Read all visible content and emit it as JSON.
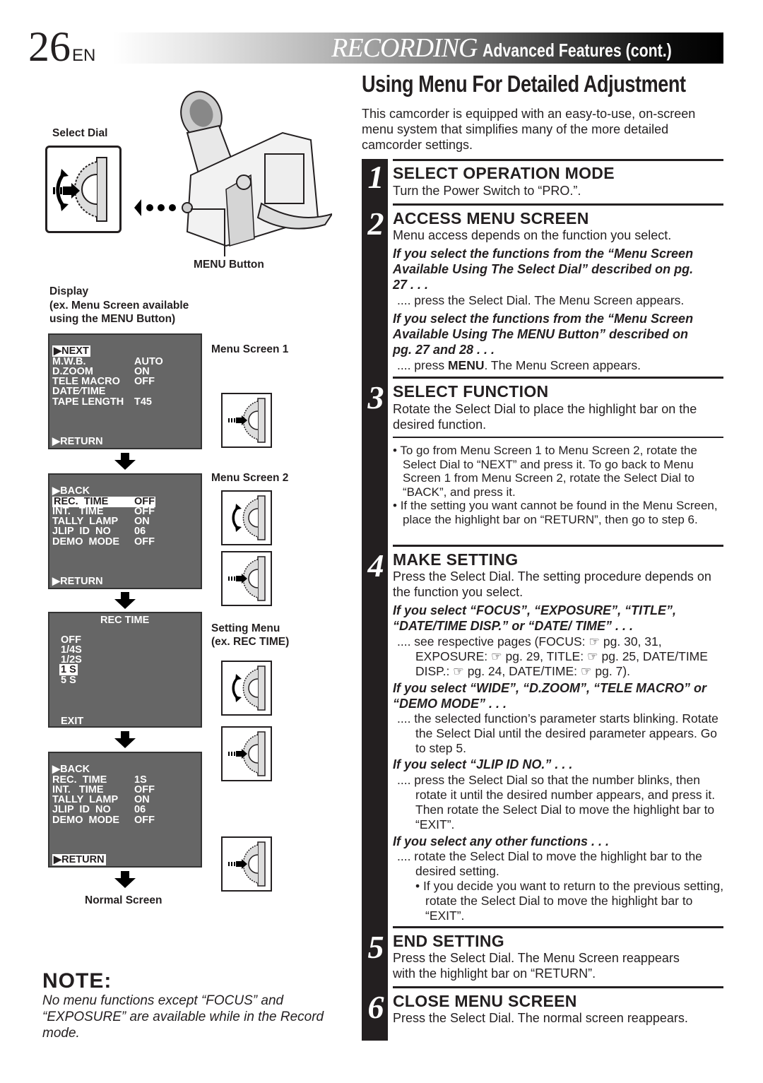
{
  "header": {
    "page_number": "26",
    "lang": "EN",
    "section": "RECORDING",
    "subsection": "Advanced Features (cont.)"
  },
  "title": "Using Menu For Detailed Adjustment",
  "intro": "This camcorder is equipped with an easy-to-use, on-screen menu system that simplifies many of the more detailed camcorder settings.",
  "illustration": {
    "select_dial_label": "Select Dial",
    "menu_button_label": "MENU Button",
    "display_label": "Display",
    "display_sub1": "(ex. Menu Screen available",
    "display_sub2": "using the MENU Button)",
    "menu_screen_1_label": "Menu Screen 1",
    "menu_screen_2_label": "Menu Screen 2",
    "setting_menu_label": "Setting Menu",
    "setting_menu_sub": "(ex. REC TIME)",
    "normal_screen_label": "Normal Screen"
  },
  "screens": {
    "menu1": {
      "rows": [
        {
          "label": "▶NEXT",
          "value": "",
          "highlight": true
        },
        {
          "label": "M.W.B.",
          "value": "AUTO"
        },
        {
          "label": "D.ZOOM",
          "value": "ON"
        },
        {
          "label": "TELE MACRO",
          "value": "OFF"
        },
        {
          "label": "DATE⁄TIME",
          "value": ""
        },
        {
          "label": "TAPE LENGTH",
          "value": "T45"
        }
      ],
      "footer": "▶RETURN"
    },
    "menu2": {
      "rows": [
        {
          "label": "▶BACK",
          "value": ""
        },
        {
          "label": "REC.  TIME",
          "value": "OFF",
          "highlight": true
        },
        {
          "label": "INT.   TIME",
          "value": "OFF"
        },
        {
          "label": "TALLY  LAMP",
          "value": "ON"
        },
        {
          "label": "JLIP  ID  NO",
          "value": "06"
        },
        {
          "label": "DEMO  MODE",
          "value": "OFF"
        }
      ],
      "footer": "▶RETURN"
    },
    "setting": {
      "title": "REC TIME",
      "options": [
        "OFF",
        "1/4S",
        "1/2S",
        "1 S",
        "5 S"
      ],
      "selected": "1 S",
      "footer": "EXIT"
    },
    "menu2_after": {
      "rows": [
        {
          "label": "▶BACK",
          "value": ""
        },
        {
          "label": "REC.  TIME",
          "value": "1S"
        },
        {
          "label": "INT.   TIME",
          "value": "OFF"
        },
        {
          "label": "TALLY  LAMP",
          "value": "ON"
        },
        {
          "label": "JLIP  ID  NO",
          "value": "06"
        },
        {
          "label": "DEMO  MODE",
          "value": "OFF"
        }
      ],
      "footer": "▶RETURN"
    }
  },
  "steps": [
    {
      "num": "1",
      "heading": "SELECT OPERATION MODE",
      "text": "Turn the Power Switch to “PRO.”."
    },
    {
      "num": "2",
      "heading": "ACCESS MENU SCREEN",
      "text": "Menu access depends on the function you select.",
      "cases": [
        {
          "if": "If you select the functions from the “Menu Screen Available Using The Select Dial” described on pg. 27 . . .",
          "then": ".... press the Select Dial. The Menu Screen appears."
        },
        {
          "if": "If you select the functions from the “Menu Screen Available Using The MENU Button” described on pg. 27 and 28 . . .",
          "then_pre": ".... press ",
          "then_bold": "MENU",
          "then_post": ". The Menu Screen appears."
        }
      ]
    },
    {
      "num": "3",
      "heading": "SELECT FUNCTION",
      "text": "Rotate the Select Dial to place the highlight bar on the desired function.",
      "bullets": [
        "To go from Menu Screen 1 to Menu Screen 2, rotate the Select Dial to “NEXT” and press it. To go back to Menu Screen 1 from Menu Screen 2, rotate the Select Dial to “BACK”, and press it.",
        "If the setting you want cannot be found in the Menu Screen, place the highlight bar on “RETURN”, then go to step 6."
      ]
    },
    {
      "num": "4",
      "heading": "MAKE SETTING",
      "text": "Press the Select Dial. The setting procedure depends on the function you select.",
      "cases": [
        {
          "if": "If you select “FOCUS”, “EXPOSURE”, “TITLE”, “DATE/TIME DISP.” or “DATE/ TIME” . . .",
          "then": ".... see respective pages (FOCUS: ☞ pg. 30, 31, EXPOSURE: ☞ pg. 29, TITLE: ☞ pg. 25, DATE/TIME DISP.: ☞ pg. 24, DATE/TIME: ☞ pg. 7)."
        },
        {
          "if": "If you select “WIDE”, “D.ZOOM”, “TELE MACRO” or “DEMO MODE” . . .",
          "then": ".... the selected function’s parameter starts blinking. Rotate the Select Dial until the desired parameter appears. Go to step 5."
        },
        {
          "if": "If you select “JLIP ID NO.” . . .",
          "then": ".... press the Select Dial so that the number blinks, then rotate it until the desired number appears, and press it. Then rotate the Select Dial to move the highlight bar to “EXIT”."
        },
        {
          "if": "If you select any other functions . . .",
          "then": ".... rotate the Select Dial to move the highlight bar to the desired setting.",
          "sub_bullet": "If you decide you want to return to the previous setting, rotate the Select Dial to move the highlight bar to “EXIT”."
        }
      ]
    },
    {
      "num": "5",
      "heading": "END SETTING",
      "text": "Press the Select Dial. The Menu Screen reappears with the highlight bar on “RETURN”."
    },
    {
      "num": "6",
      "heading": "CLOSE MENU SCREEN",
      "text": "Press the Select Dial. The normal screen reappears."
    }
  ],
  "note": {
    "title": "NOTE:",
    "text": "No menu functions except “FOCUS” and “EXPOSURE” are available while in the Record mode."
  }
}
